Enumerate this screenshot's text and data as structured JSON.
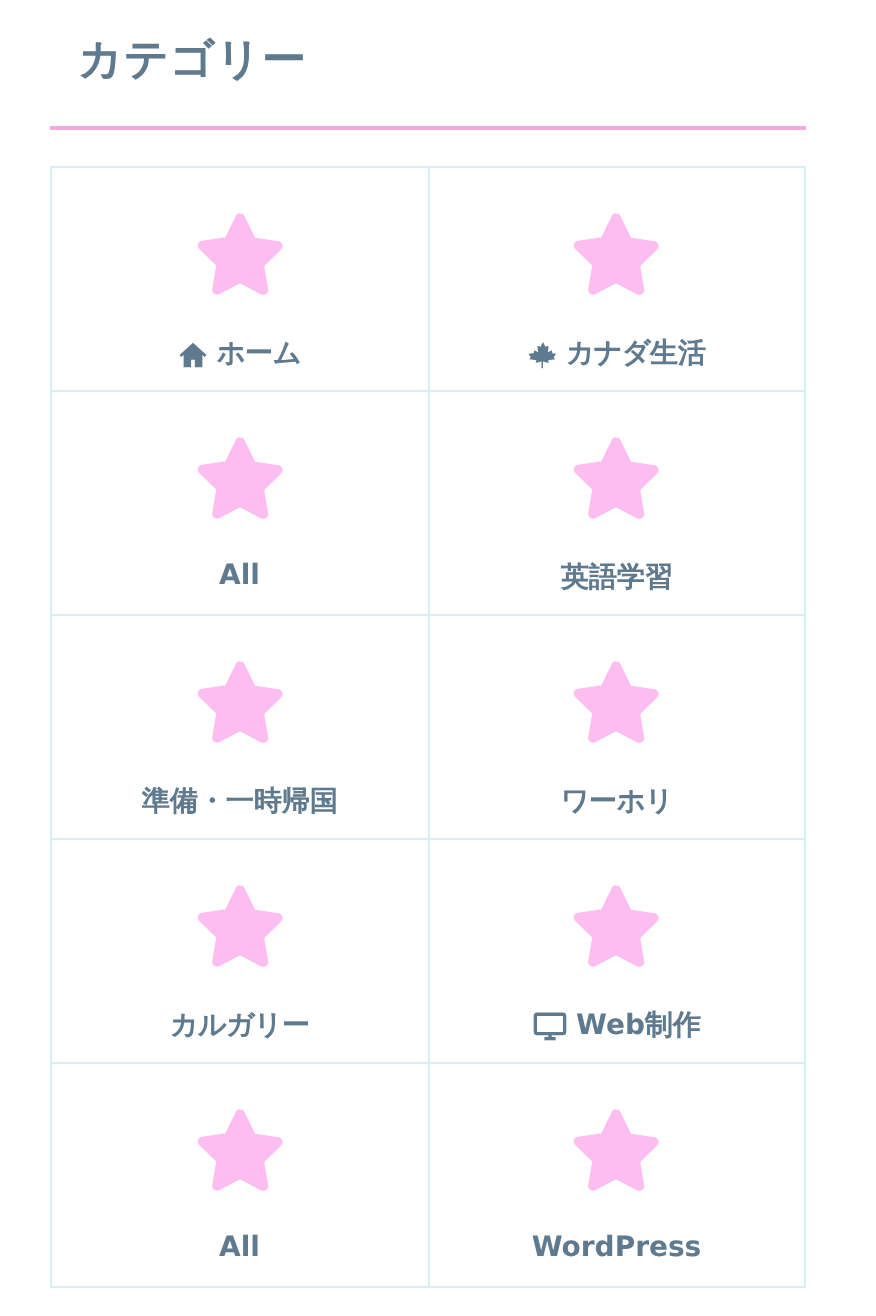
{
  "title": "カテゴリー",
  "categories": [
    {
      "label": "ホーム",
      "kind": "home"
    },
    {
      "label": "カナダ生活",
      "kind": "canada"
    },
    {
      "label": "All",
      "kind": "plain"
    },
    {
      "label": "英語学習",
      "kind": "plain"
    },
    {
      "label": "準備・一時帰国",
      "kind": "plain"
    },
    {
      "label": "ワーホリ",
      "kind": "plain"
    },
    {
      "label": "カルガリー",
      "kind": "plain"
    },
    {
      "label": "Web制作",
      "kind": "web"
    },
    {
      "label": "All",
      "kind": "plain"
    },
    {
      "label": "WordPress",
      "kind": "plain"
    }
  ]
}
